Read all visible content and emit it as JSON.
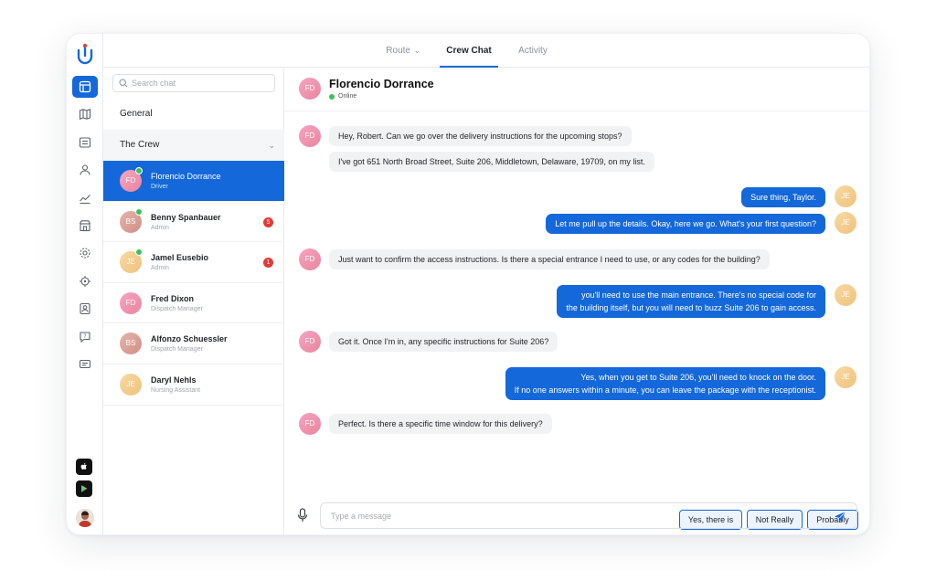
{
  "tabs": [
    {
      "label": "Route"
    },
    {
      "label": "Crew Chat"
    },
    {
      "label": "Activity"
    }
  ],
  "search": {
    "placeholder": "Search chat"
  },
  "groups": {
    "general": "General",
    "crew": "The Crew"
  },
  "contacts": [
    {
      "initials": "FD",
      "name": "Florencio Dorrance",
      "role": "Driver",
      "online": true,
      "badge": null
    },
    {
      "initials": "BS",
      "name": "Benny Spanbauer",
      "role": "Admin",
      "online": true,
      "badge": "5"
    },
    {
      "initials": "JE",
      "name": "Jamel Eusebio",
      "role": "Admin",
      "online": true,
      "badge": "1"
    },
    {
      "initials": "FD",
      "name": "Fred Dixon",
      "role": "Dispatch Manager",
      "online": false,
      "badge": null
    },
    {
      "initials": "BS",
      "name": "Alfonzo Schuessler",
      "role": "Dispatch Manager",
      "online": false,
      "badge": null
    },
    {
      "initials": "JE",
      "name": "Daryl Nehls",
      "role": "Nursing Assistant",
      "online": false,
      "badge": null
    }
  ],
  "conversation": {
    "name": "Florencio Dorrance",
    "initials": "FD",
    "status": "Online",
    "me_initials": "JE",
    "messages": [
      {
        "from": "them",
        "text": "Hey, Robert. Can we go over the delivery instructions for the upcoming stops?"
      },
      {
        "from": "them",
        "text": "I've got 651 North Broad Street, Suite 206, Middletown, Delaware, 19709, on my list."
      },
      {
        "from": "me",
        "text": "Sure thing, Taylor."
      },
      {
        "from": "me",
        "text": "Let me pull up the details. Okay, here we go. What's your first question?"
      },
      {
        "from": "them",
        "text": "Just want to confirm the access instructions. Is there a special entrance I need to use, or any codes for the building?"
      },
      {
        "from": "me",
        "line1": "you'll need to use the main entrance. There's no special code for",
        "line2": "the building itself, but you will need to buzz Suite 206 to gain access."
      },
      {
        "from": "them",
        "text": "Got it. Once I'm in, any specific instructions for Suite 206?"
      },
      {
        "from": "me",
        "line1": "Yes, when you get to Suite 206, you'll need to knock on the door.",
        "line2": "If no one answers within a minute, you can leave the package with the receptionist."
      },
      {
        "from": "them",
        "text": "Perfect. Is there a specific time window for this delivery?"
      }
    ]
  },
  "quick_replies": [
    "Yes, there is",
    "Not Really",
    "Probably"
  ],
  "composer": {
    "placeholder": "Type a message"
  },
  "colors": {
    "accent": "#1468d9",
    "badge": "#e53935",
    "online": "#3fbf5a"
  }
}
